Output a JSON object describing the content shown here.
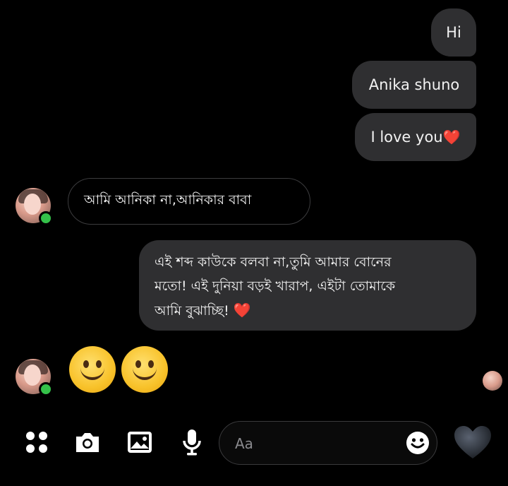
{
  "messages": {
    "sent_hi": "Hi",
    "sent_anika": "Anika shuno",
    "sent_love": "I love you",
    "sent_love_emoji": "❤️",
    "received_1": "আমি আনিকা না,আনিকার বাবা",
    "sent_long_line1": "এই শব্দ কাউকে বলবা না,তুমি আমার বোনের",
    "sent_long_line2": "মতো! এই দুনিয়া বড়ই খারাপ, এইটা তোমাকে",
    "sent_long_line3": "আমি বুঝাচ্ছি!",
    "sent_long_emoji": "❤️",
    "received_emojis": [
      "🙂",
      "🙂"
    ]
  },
  "composer": {
    "placeholder": "Aa"
  },
  "icons": {
    "more": "grid-dots-icon",
    "camera": "camera-icon",
    "gallery": "gallery-icon",
    "mic": "microphone-icon",
    "emoji": "smiley-icon",
    "like": "heart-icon"
  },
  "colors": {
    "background": "#000000",
    "bubble": "#2f2f31",
    "heart": "#e8263c",
    "online": "#35c24a"
  }
}
